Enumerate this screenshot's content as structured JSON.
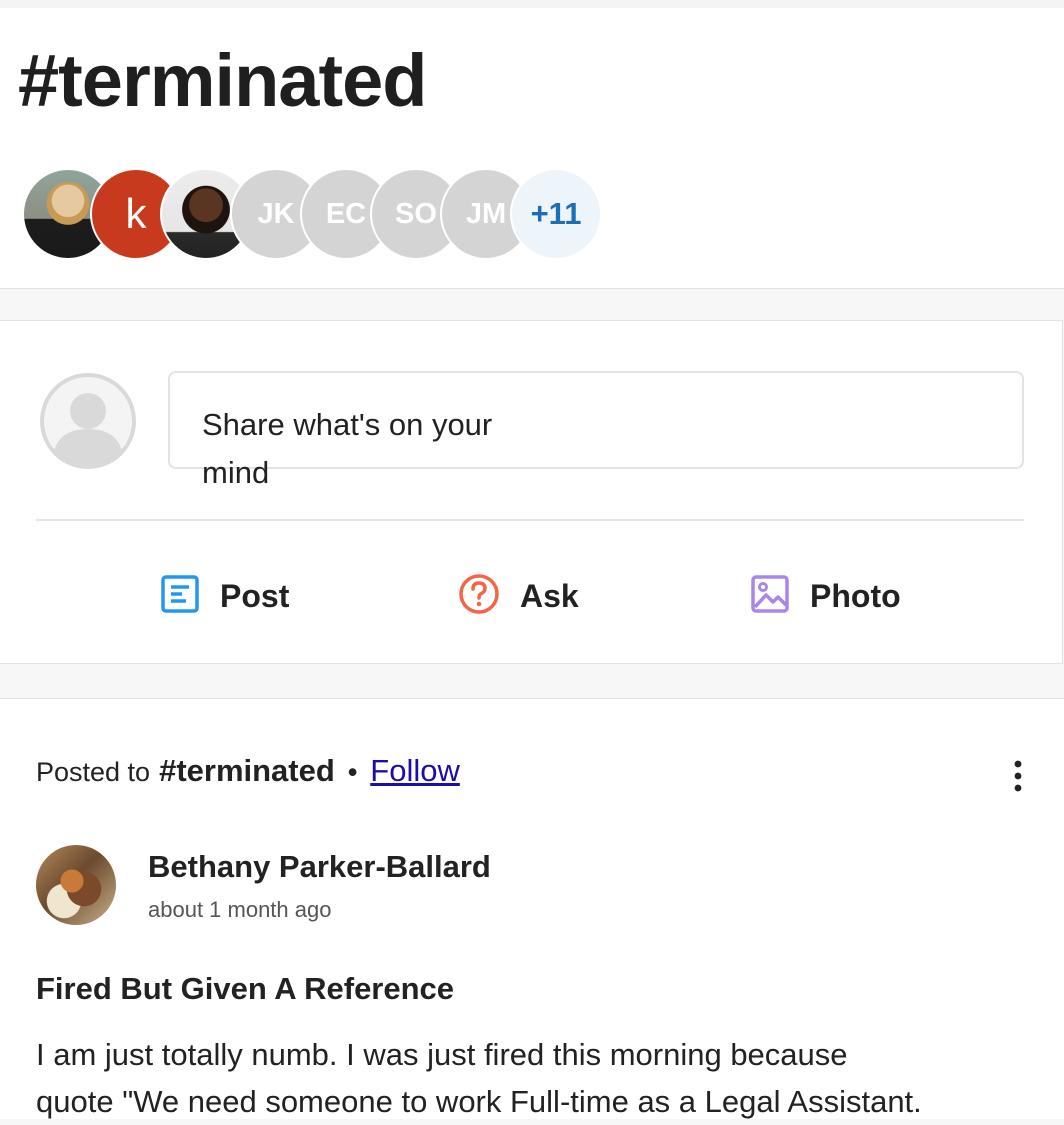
{
  "header": {
    "title": "#terminated",
    "members": [
      {
        "type": "photo",
        "name": "member-photo-1"
      },
      {
        "type": "letter",
        "text": "k"
      },
      {
        "type": "photo",
        "name": "member-photo-3"
      },
      {
        "type": "initials",
        "text": "JK"
      },
      {
        "type": "initials",
        "text": "EC"
      },
      {
        "type": "initials",
        "text": "SO"
      },
      {
        "type": "initials",
        "text": "JM"
      },
      {
        "type": "more",
        "text": "+11"
      }
    ]
  },
  "composer": {
    "placeholder_line1": "Share what's on your",
    "placeholder_line2": "mind",
    "actions": {
      "post": "Post",
      "ask": "Ask",
      "photo": "Photo"
    }
  },
  "post": {
    "posted_to_label": "Posted to",
    "tag": "#terminated",
    "separator": "•",
    "follow_label": "Follow",
    "author": "Bethany Parker-Ballard",
    "time": "about 1 month ago",
    "title": "Fired But Given A Reference",
    "body_line1": "I am just totally numb. I was just fired this morning because",
    "body_line2": "quote \"We need someone to work Full-time as a Legal Assistant."
  },
  "colors": {
    "post_icon": "#2196f3",
    "ask_icon": "#f26645",
    "photo_icon": "#a987e8",
    "more_text": "#1d6fb5",
    "link": "#1a0dab"
  }
}
